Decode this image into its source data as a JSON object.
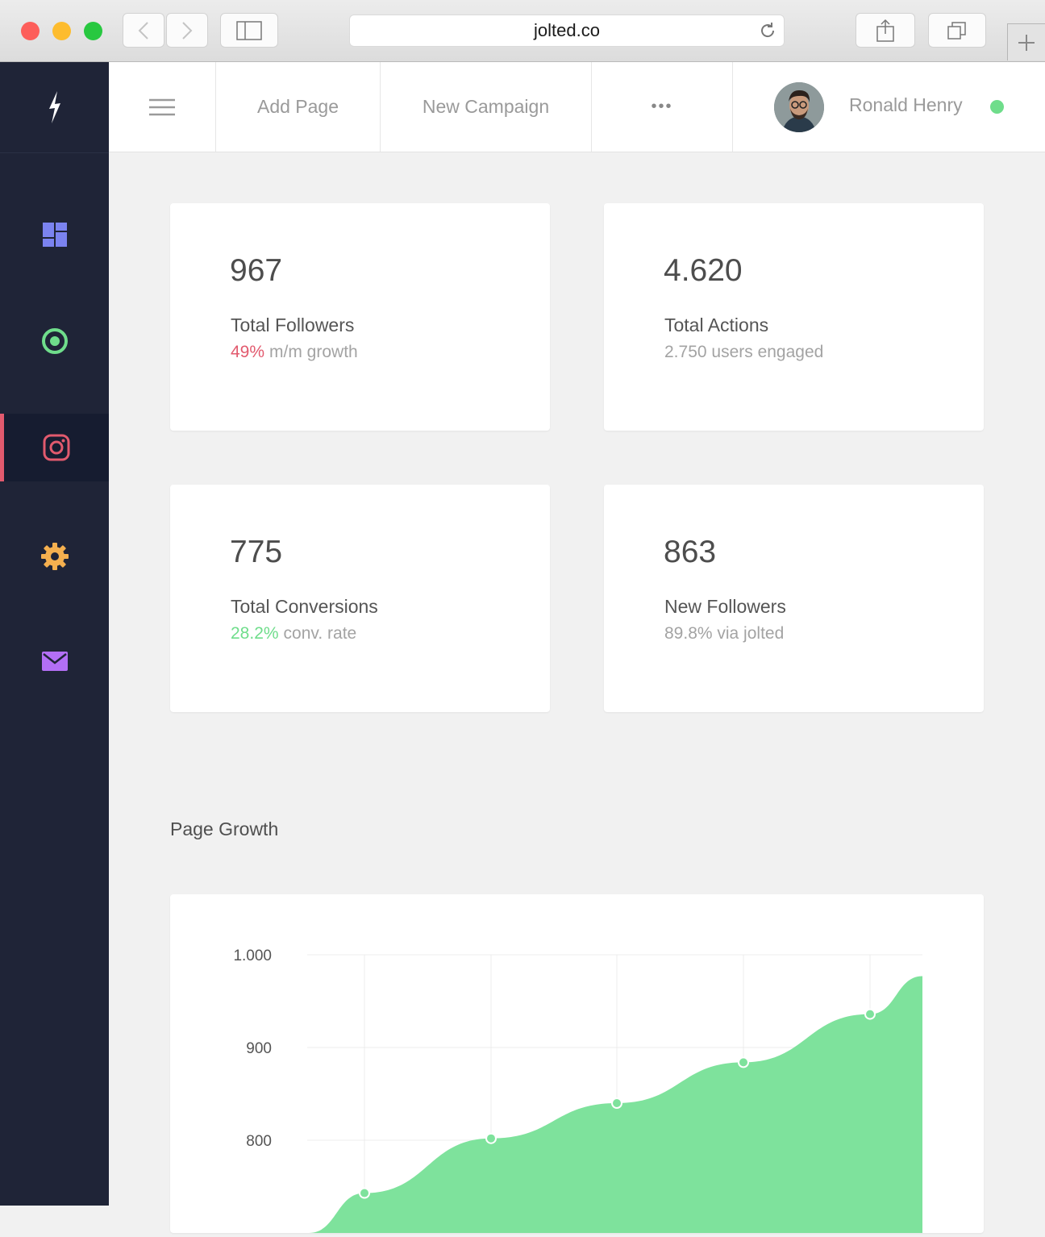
{
  "browser": {
    "url": "jolted.co"
  },
  "topbar": {
    "add_page": "Add Page",
    "new_campaign": "New Campaign",
    "more": "•••",
    "user_name": "Ronald Henry",
    "status_color": "#6fdd8b"
  },
  "sidebar": {
    "items": [
      {
        "icon": "dashboard-icon",
        "color": "#7b83f0"
      },
      {
        "icon": "target-icon",
        "color": "#6fdd8b"
      },
      {
        "icon": "instagram-icon",
        "color": "#e25a6e",
        "active": true
      },
      {
        "icon": "gear-icon",
        "color": "#f5b04f"
      },
      {
        "icon": "mail-icon",
        "color": "#b36ff5"
      }
    ]
  },
  "stats": [
    {
      "value": "967",
      "label": "Total Followers",
      "highlight": "49%",
      "highlight_color": "#e25a6e",
      "sub": "m/m growth"
    },
    {
      "value": "4.620",
      "label": "Total Actions",
      "highlight": "",
      "sub": "2.750 users engaged"
    },
    {
      "value": "775",
      "label": "Total Conversions",
      "highlight": "28.2%",
      "highlight_color": "#6fdd8b",
      "sub": "conv. rate"
    },
    {
      "value": "863",
      "label": "New Followers",
      "highlight": "",
      "sub": "89.8% via jolted"
    }
  ],
  "section": {
    "page_growth": "Page Growth"
  },
  "chart_data": {
    "type": "area",
    "y_ticks": [
      "1.000",
      "900",
      "800"
    ],
    "ylim": [
      700,
      1000
    ],
    "points": [
      743,
      802,
      840,
      884,
      936
    ],
    "end_value": 977,
    "color": "#7ee29c"
  }
}
